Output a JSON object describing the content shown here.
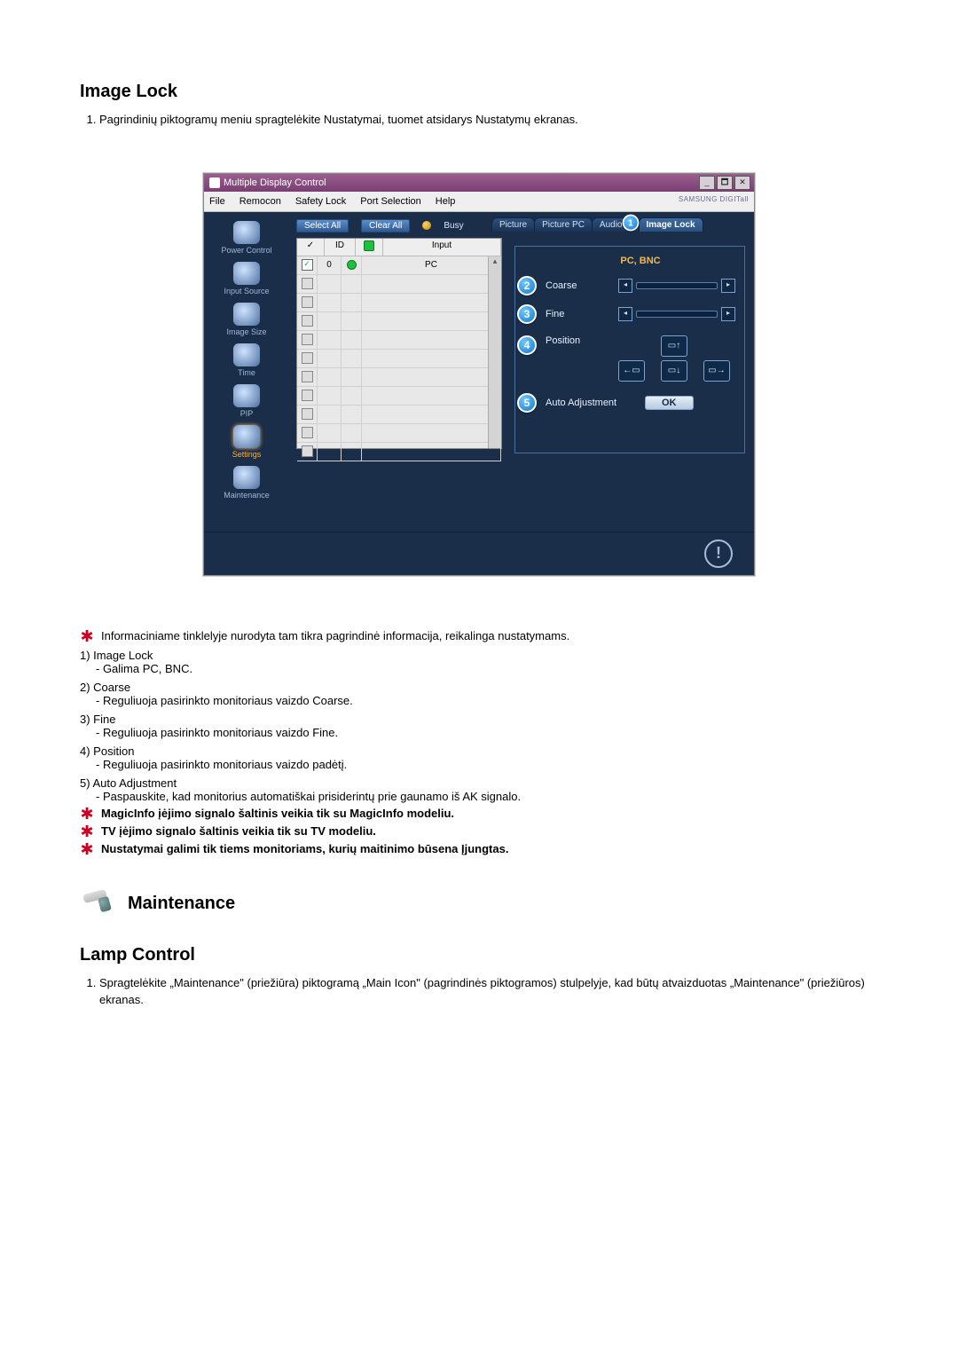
{
  "section1_title": "Image Lock",
  "section1_step": "Pagrindinių piktogramų meniu spragtelėkite Nustatymai, tuomet atsidarys Nustatymų ekranas.",
  "info_star": "Informaciniame tinklelyje nurodyta tam tikra pagrindinė informacija, reikalinga nustatymams.",
  "items": [
    {
      "head": "1)  Image Lock",
      "sub": "- Galima PC, BNC."
    },
    {
      "head": "2)  Coarse",
      "sub": "- Reguliuoja pasirinkto monitoriaus vaizdo Coarse."
    },
    {
      "head": "3)  Fine",
      "sub": "- Reguliuoja pasirinkto monitoriaus vaizdo Fine."
    },
    {
      "head": "4)  Position",
      "sub": "- Reguliuoja pasirinkto monitoriaus vaizdo padėtį."
    },
    {
      "head": "5)  Auto Adjustment",
      "sub": "- Paspauskite, kad monitorius automatiškai prisiderintų prie gaunamo iš AK signalo."
    }
  ],
  "bold_notes": [
    "MagicInfo įėjimo signalo šaltinis veikia tik su MagicInfo modeliu.",
    "TV įėjimo signalo šaltinis veikia tik su TV modeliu.",
    "Nustatymai galimi tik tiems monitoriams, kurių maitinimo būsena Įjungtas."
  ],
  "maintenance_title": "Maintenance",
  "section2_title": "Lamp Control",
  "section2_step": "Spragtelėkite „Maintenance\" (priežiūra) piktogramą „Main Icon\" (pagrindinės piktogramos) stulpelyje, kad būtų atvaizduotas „Maintenance\" (priežiūros) ekranas.",
  "app": {
    "title": "Multiple Display Control",
    "menu": [
      "File",
      "Remocon",
      "Safety Lock",
      "Port Selection",
      "Help"
    ],
    "brand": "SAMSUNG DIGITall",
    "toolbar": {
      "select_all": "Select All",
      "clear_all": "Clear All",
      "busy": "Busy"
    },
    "sidebar": [
      {
        "label": "Power Control"
      },
      {
        "label": "Input Source"
      },
      {
        "label": "Image Size"
      },
      {
        "label": "Time"
      },
      {
        "label": "PIP"
      },
      {
        "label": "Settings",
        "active": true
      },
      {
        "label": "Maintenance"
      }
    ],
    "list": {
      "cols": {
        "chk": "✓",
        "id": "ID",
        "st": "",
        "input": "Input"
      },
      "rows": [
        {
          "chk": true,
          "id": "0",
          "st": "on",
          "input": "PC"
        },
        {
          "chk": false
        },
        {
          "chk": false
        },
        {
          "chk": false
        },
        {
          "chk": false
        },
        {
          "chk": false
        },
        {
          "chk": false
        },
        {
          "chk": false
        },
        {
          "chk": false
        },
        {
          "chk": false
        },
        {
          "chk": false
        }
      ]
    },
    "tabs": {
      "picture": "Picture",
      "picture_pc": "Picture PC",
      "audio": "Audio",
      "image_lock": "Image Lock"
    },
    "panel": {
      "pcbnc": "PC, BNC",
      "coarse": "Coarse",
      "fine": "Fine",
      "position": "Position",
      "auto_adj": "Auto Adjustment",
      "ok": "OK"
    },
    "badges": {
      "n1": "1",
      "n2": "2",
      "n3": "3",
      "n4": "4",
      "n5": "5"
    }
  }
}
